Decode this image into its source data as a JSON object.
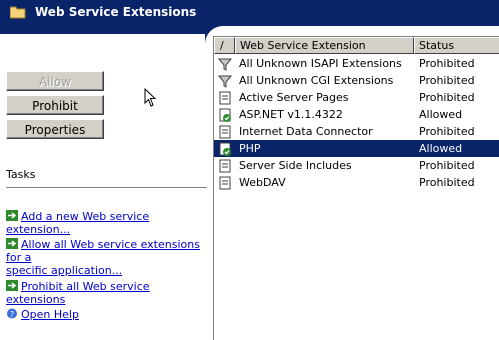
{
  "header": {
    "title": "Web Service Extensions",
    "icon": "folder-icon"
  },
  "buttons": {
    "allow": "Allow",
    "prohibit": "Prohibit",
    "properties": "Properties"
  },
  "tasks": {
    "label": "Tasks",
    "items": [
      {
        "line1": "Add a new Web service extension...",
        "line2": ""
      },
      {
        "line1": "Allow all Web service extensions for a",
        "line2": "specific application..."
      },
      {
        "line1": "Prohibit all Web service extensions",
        "line2": ""
      },
      {
        "line1": "Open Help",
        "line2": ""
      }
    ]
  },
  "list": {
    "columns": {
      "sort": "/",
      "name": "Web Service Extension",
      "status": "Status"
    },
    "rows": [
      {
        "name": "All Unknown ISAPI Extensions",
        "status": "Prohibited",
        "icon": "filter-icon"
      },
      {
        "name": "All Unknown CGI Extensions",
        "status": "Prohibited",
        "icon": "filter-icon"
      },
      {
        "name": "Active Server Pages",
        "status": "Prohibited",
        "icon": "extension-icon"
      },
      {
        "name": "ASP.NET v1.1.4322",
        "status": "Allowed",
        "icon": "extension-allowed-icon"
      },
      {
        "name": "Internet Data Connector",
        "status": "Prohibited",
        "icon": "extension-icon"
      },
      {
        "name": "PHP",
        "status": "Allowed",
        "icon": "extension-allowed-icon",
        "selected": true
      },
      {
        "name": "Server Side Includes",
        "status": "Prohibited",
        "icon": "extension-icon"
      },
      {
        "name": "WebDAV",
        "status": "Prohibited",
        "icon": "extension-icon"
      }
    ]
  },
  "colors": {
    "header_bg": "#0a246a",
    "selection": "#0a246a",
    "link": "#0000cc",
    "button_face": "#d4d0c8"
  }
}
